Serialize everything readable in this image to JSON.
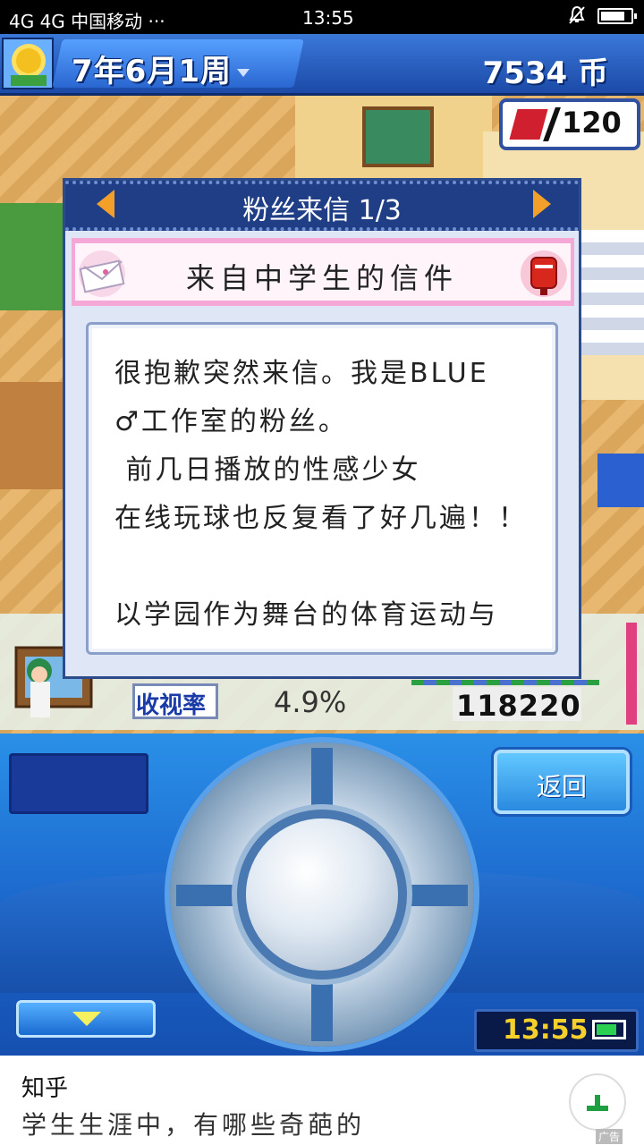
{
  "status_bar": {
    "carrier": "4G 4G 中国移动 ···",
    "time": "13:55"
  },
  "hud": {
    "date": "7年6月1周",
    "money": "7534 币",
    "item_count": "120"
  },
  "dialog": {
    "title": "粉丝来信 1/3",
    "subtitle": "来自中学生的信件",
    "letter_lines": [
      "很抱歉突然来信。我是BLUE",
      "♂工作室的粉丝。",
      " 前几日播放的性感少女",
      "在线玩球也反复看了好几遍！！",
      "",
      "以学园作为舞台的体育运动与"
    ]
  },
  "ratings": {
    "label": "收视率",
    "value": "4.9%",
    "viewers": "118220"
  },
  "controls": {
    "back_label": "返回",
    "clock": "13:55"
  },
  "ad": {
    "title": "知乎",
    "text": "学生生涯中，有哪些奇葩的",
    "tag": "广告"
  }
}
